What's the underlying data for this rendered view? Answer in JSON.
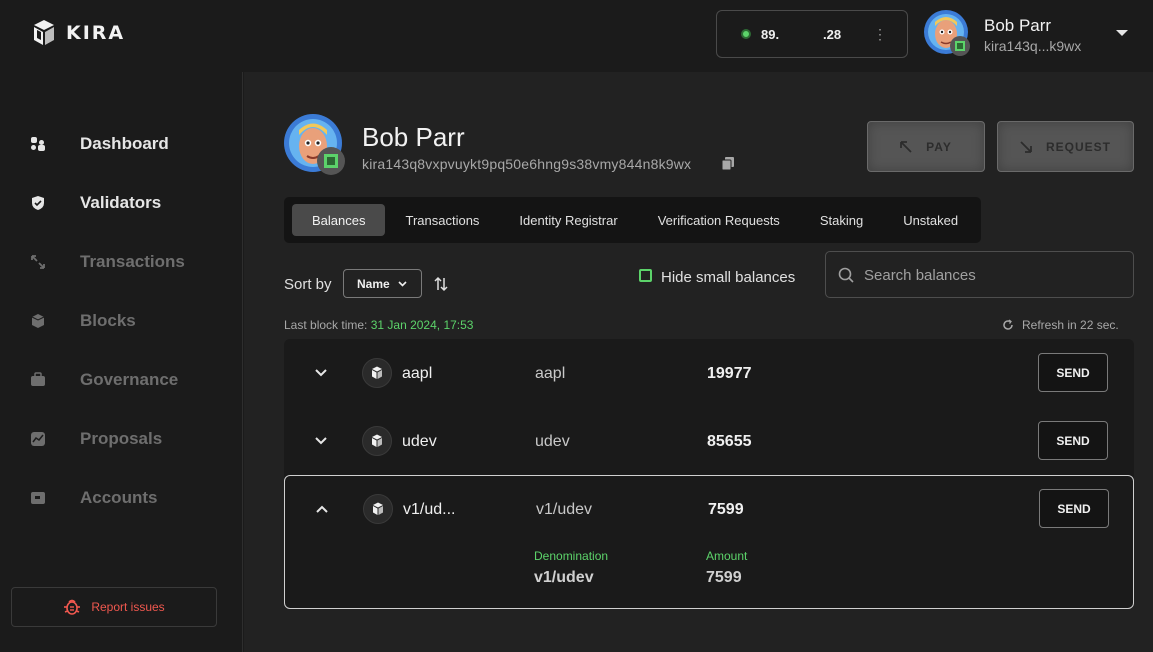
{
  "brand": {
    "name": "KIRA"
  },
  "node": {
    "ip_start": "89.",
    "ip_end": ".28",
    "status_color": "#5cd36a"
  },
  "user": {
    "name": "Bob Parr",
    "short_address": "kira143q...k9wx"
  },
  "sidebar": {
    "items": [
      {
        "label": "Dashboard",
        "icon": "dashboard-icon",
        "active": true
      },
      {
        "label": "Validators",
        "icon": "shield-icon",
        "active": true
      },
      {
        "label": "Transactions",
        "icon": "transfer-icon",
        "active": false
      },
      {
        "label": "Blocks",
        "icon": "cube-icon",
        "active": false
      },
      {
        "label": "Governance",
        "icon": "briefcase-icon",
        "active": false
      },
      {
        "label": "Proposals",
        "icon": "chart-icon",
        "active": false
      },
      {
        "label": "Accounts",
        "icon": "wallet-icon",
        "active": false
      }
    ],
    "report_label": "Report issues"
  },
  "profile": {
    "name": "Bob Parr",
    "address": "kira143q8vxpvuykt9pq50e6hng9s38vmy844n8k9wx",
    "pay_label": "PAY",
    "request_label": "REQUEST"
  },
  "tabs": [
    {
      "label": "Balances",
      "active": true
    },
    {
      "label": "Transactions",
      "active": false
    },
    {
      "label": "Identity Registrar",
      "active": false
    },
    {
      "label": "Verification Requests",
      "active": false
    },
    {
      "label": "Staking",
      "active": false
    },
    {
      "label": "Unstaked",
      "active": false
    }
  ],
  "controls": {
    "sort_label": "Sort by",
    "sort_value": "Name",
    "hide_small_label": "Hide small balances",
    "search_placeholder": "Search balances",
    "last_block_label": "Last block time:",
    "last_block_value": "31 Jan 2024, 17:53",
    "refresh_label": "Refresh in 22 sec."
  },
  "balances": [
    {
      "name": "aapl",
      "denom": "aapl",
      "amount": "19977",
      "send_label": "SEND",
      "expanded": false
    },
    {
      "name": "udev",
      "denom": "udev",
      "amount": "85655",
      "send_label": "SEND",
      "expanded": false
    },
    {
      "name": "v1/ud...",
      "denom": "v1/udev",
      "amount": "7599",
      "send_label": "SEND",
      "expanded": true,
      "details": {
        "denomination_label": "Denomination",
        "denomination_value": "v1/udev",
        "amount_label": "Amount",
        "amount_value": "7599"
      }
    }
  ],
  "colors": {
    "accent": "#5cd36a",
    "danger": "#f0584f",
    "background": "#1b1b1b"
  }
}
